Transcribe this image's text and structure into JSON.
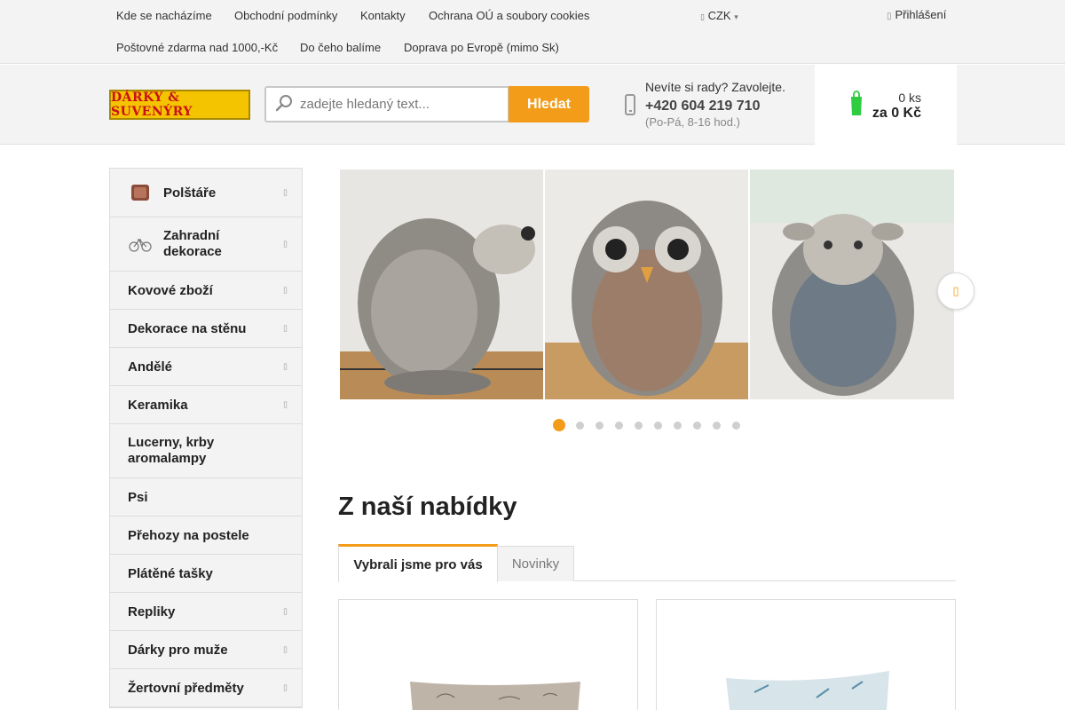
{
  "top_nav": {
    "row1": [
      "Kde se nacházíme",
      "Obchodní podmínky",
      "Kontakty",
      "Ochrana OÚ a soubory cookies"
    ],
    "row2": [
      "Poštovné zdarma nad 1000,-Kč",
      "Do čeho balíme",
      "Doprava po Evropě (mimo Sk)"
    ],
    "currency": "CZK",
    "login": "Přihlášení"
  },
  "header": {
    "logo_text": "DÁRKY & SUVENÝRY",
    "search_placeholder": "zadejte hledaný text...",
    "search_button": "Hledat",
    "help_question": "Nevíte si rady? Zavolejte.",
    "help_phone": "+420 604 219 710",
    "help_hours": "(Po-Pá, 8-16 hod.)",
    "cart_count": "0 ks",
    "cart_total": "za 0 Kč"
  },
  "sidebar": {
    "items": [
      {
        "label": "Polštáře",
        "has_submenu": true,
        "icon": "pillow-thumbnail"
      },
      {
        "label": "Zahradní dekorace",
        "has_submenu": true,
        "icon": "bicycle-thumbnail"
      },
      {
        "label": "Kovové zboží",
        "has_submenu": true
      },
      {
        "label": "Dekorace na stěnu",
        "has_submenu": true
      },
      {
        "label": "Andělé",
        "has_submenu": true
      },
      {
        "label": "Keramika",
        "has_submenu": true
      },
      {
        "label": "Lucerny, krby aromalampy",
        "has_submenu": false
      },
      {
        "label": "Psi",
        "has_submenu": false
      },
      {
        "label": "Přehozy na postele",
        "has_submenu": false
      },
      {
        "label": "Plátěné tašky",
        "has_submenu": false
      },
      {
        "label": "Repliky",
        "has_submenu": true
      },
      {
        "label": "Dárky pro muže",
        "has_submenu": true
      },
      {
        "label": "Žertovní předměty",
        "has_submenu": true
      }
    ]
  },
  "carousel": {
    "slides": [
      "hedgehog-figurine-photo",
      "owl-figurine-photo",
      "sheep-figurine-photo"
    ],
    "dot_count": 10,
    "active_dot": 1
  },
  "offers": {
    "title": "Z naší nabídky",
    "tabs": [
      "Vybrali jsme pro vás",
      "Novinky"
    ],
    "active_tab": 0,
    "cards": [
      "pillow-product-1",
      "pillow-product-2"
    ]
  },
  "colors": {
    "accent": "#f39c1a",
    "logo_bg": "#f5c400",
    "logo_text": "#c8101a",
    "bar_bg": "#f3f3f3"
  }
}
